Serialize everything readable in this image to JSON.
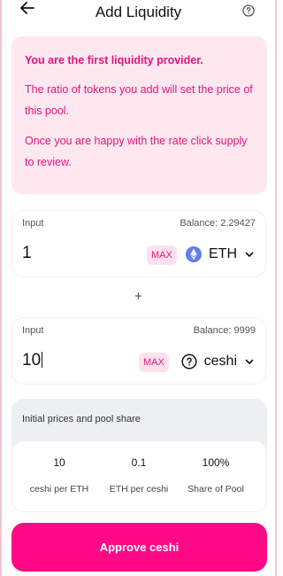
{
  "header": {
    "title": "Add Liquidity"
  },
  "info": {
    "bold": "You are the first liquidity provider.",
    "line1": "The ratio of tokens you add will set the price of this pool.",
    "line2": "Once you are happy with the rate click supply to review."
  },
  "input1": {
    "label": "Input",
    "balance": "Balance: 2.29427",
    "amount": "1",
    "max_label": "MAX",
    "token": "ETH",
    "token_icon": "ethereum-icon"
  },
  "plus_sign": "+",
  "input2": {
    "label": "Input",
    "balance": "Balance: 9999",
    "amount": "10",
    "max_label": "MAX",
    "token": "ceshi",
    "token_icon": "unknown-token-icon"
  },
  "prices": {
    "heading": "Initial prices and pool share",
    "stats": [
      {
        "value": "10",
        "label": "ceshi per ETH"
      },
      {
        "value": "0.1",
        "label": "ETH per ceshi"
      },
      {
        "value": "100%",
        "label": "Share of Pool"
      }
    ]
  },
  "approve_label": "Approve ceshi",
  "colors": {
    "accent": "#fe0a86",
    "info_bg": "#fde8ef",
    "info_text": "#e8127f",
    "eth_blue": "#627eea"
  }
}
